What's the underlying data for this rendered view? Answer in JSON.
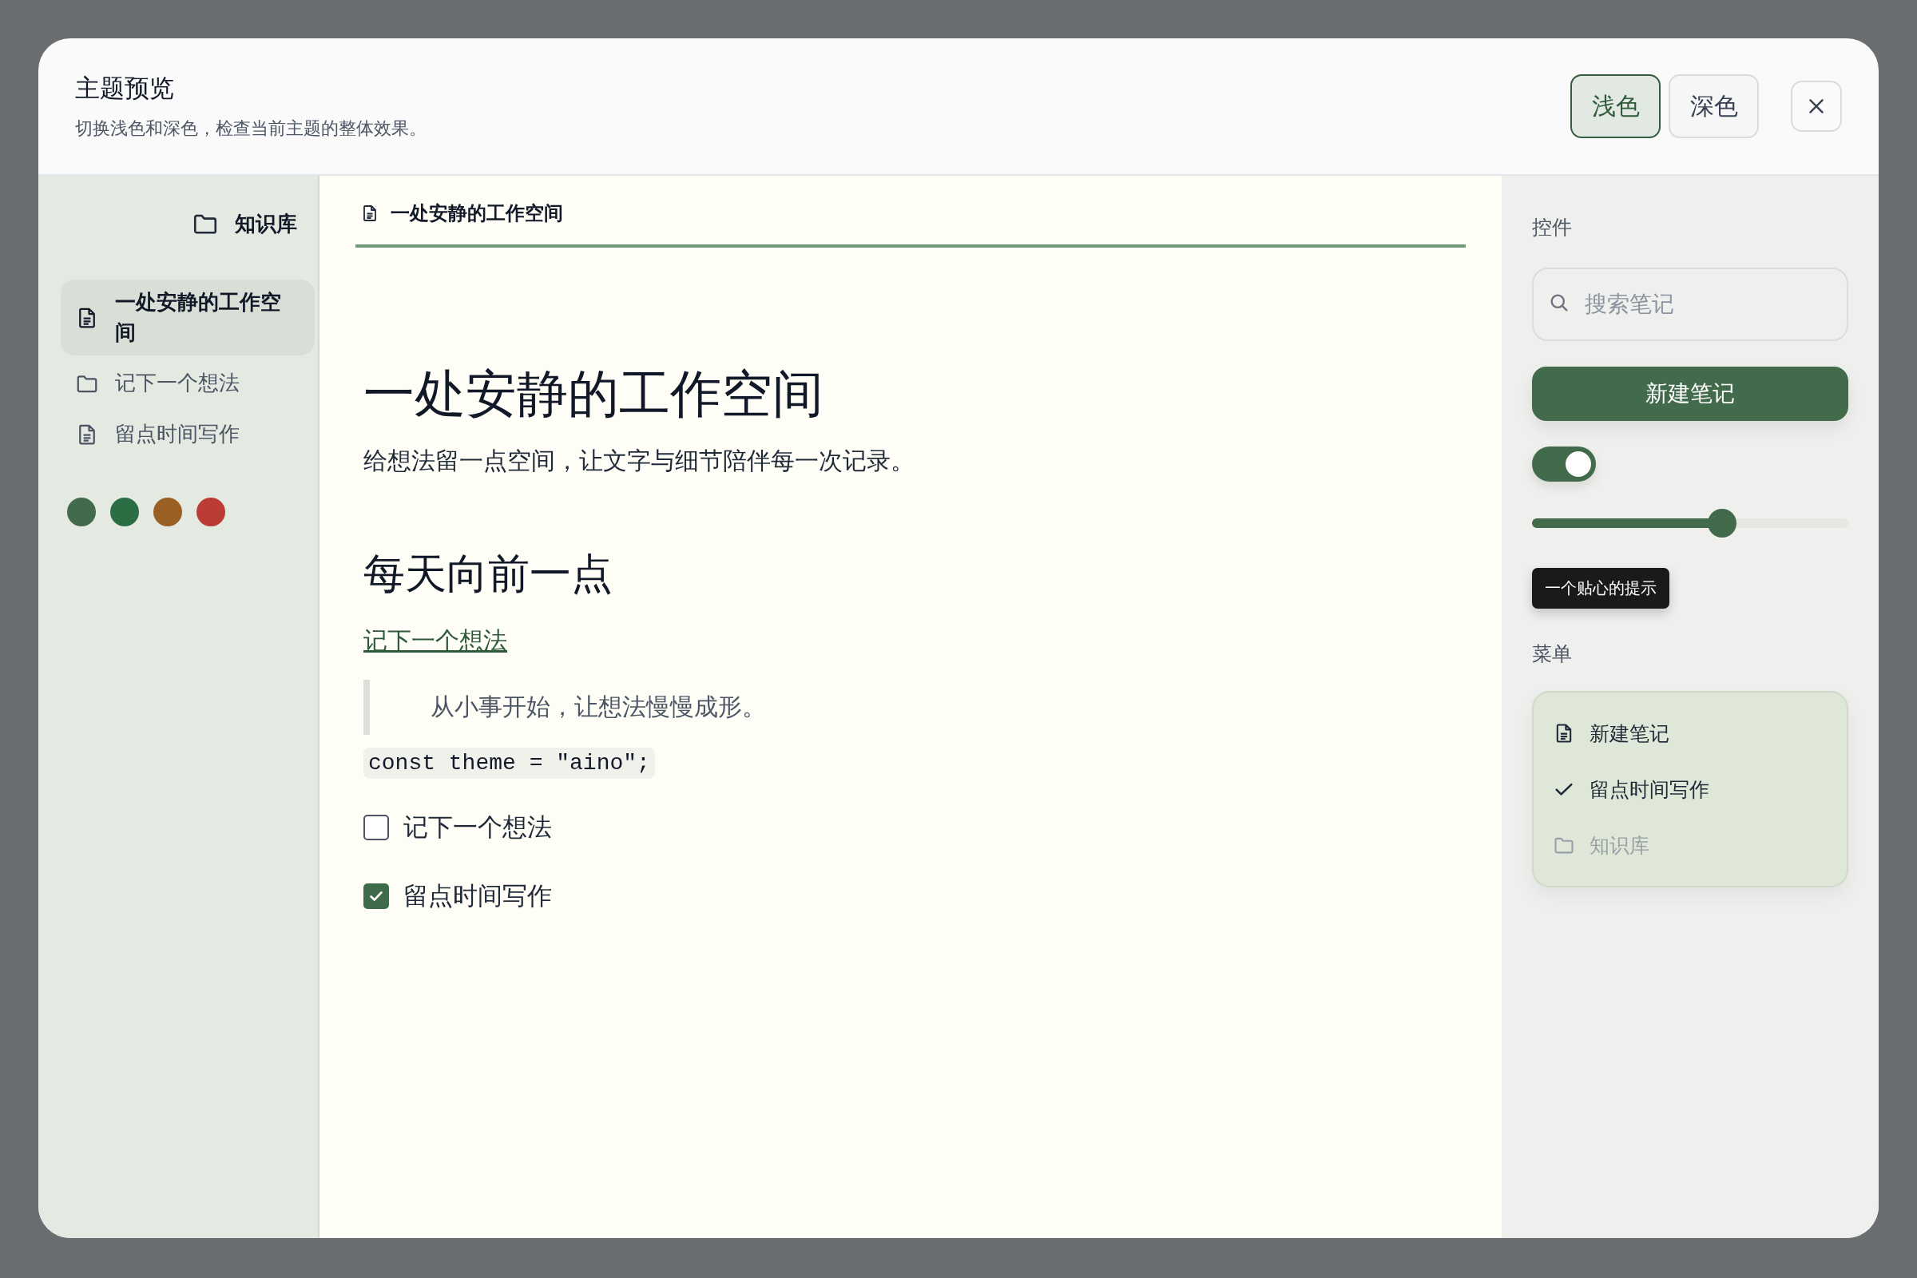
{
  "dialog": {
    "title": "主题预览",
    "subtitle": "切换浅色和深色，检查当前主题的整体效果。"
  },
  "theme_buttons": [
    {
      "label": "浅色",
      "selected": true
    },
    {
      "label": "深色",
      "selected": false
    }
  ],
  "sidebar": {
    "header": "知识库",
    "items": [
      {
        "label": "一处安静的工作空间",
        "kind": "document",
        "selected": true
      },
      {
        "label": "记下一个想法",
        "kind": "folder",
        "selected": false
      },
      {
        "label": "留点时间写作",
        "kind": "document",
        "selected": false
      }
    ],
    "color_dots": [
      {
        "color": "#416b4b"
      },
      {
        "color": "#2c6e44"
      },
      {
        "color": "#9a5f22"
      },
      {
        "color": "#bb3b35"
      }
    ]
  },
  "document": {
    "tab": "一处安静的工作空间",
    "blocks": [
      {
        "kind": "h1",
        "text": "一处安静的工作空间"
      },
      {
        "kind": "paragraph",
        "text": "给想法留一点空间，让文字与细节陪伴每一次记录。"
      },
      {
        "kind": "h2",
        "text": "每天向前一点"
      },
      {
        "kind": "link",
        "text": "记下一个想法"
      },
      {
        "kind": "quote",
        "text": "从小事开始，让想法慢慢成形。"
      },
      {
        "kind": "code",
        "text": "const theme = \"aino\";"
      },
      {
        "kind": "task",
        "text": "记下一个想法",
        "checked": false
      },
      {
        "kind": "task",
        "text": "留点时间写作",
        "checked": true
      }
    ]
  },
  "controls": {
    "heading": "控件",
    "search": {
      "placeholder": "搜索笔记"
    },
    "button": "新建笔记",
    "toggle": {
      "on": true
    },
    "slider": {
      "level": 0.6
    },
    "tooltip": "一个贴心的提示"
  },
  "menu": {
    "heading": "菜单",
    "items": [
      {
        "label": "新建笔记",
        "kind": "document",
        "disabled": false
      },
      {
        "label": "留点时间写作",
        "kind": "check",
        "disabled": false
      },
      {
        "label": "知识库",
        "kind": "folder",
        "disabled": true
      }
    ]
  }
}
